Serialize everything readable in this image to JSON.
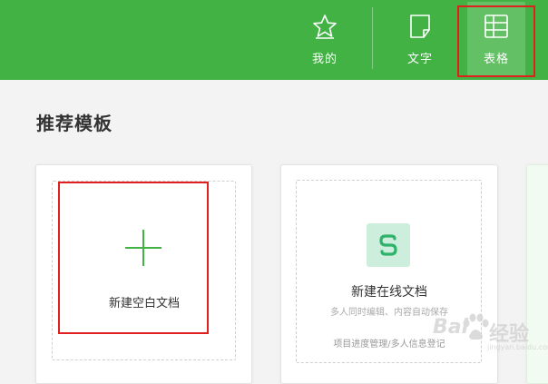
{
  "nav": {
    "mine_label": "我的",
    "text_label": "文字",
    "sheet_label": "表格"
  },
  "section_title": "推荐模板",
  "cards": {
    "blank_label": "新建空白文档",
    "online_title": "新建在线文档",
    "online_subtitle": "多人同时编辑、内容自动保存",
    "online_tags": "项目进度管理/多人信息登记"
  },
  "watermark": {
    "brand": "Bai",
    "brand_cn": "经验",
    "url": "jingyan.baidu.com"
  },
  "colors": {
    "accent": "#43b244",
    "highlight": "#e0201f",
    "sheet_icon_bg": "#cdeedd"
  }
}
